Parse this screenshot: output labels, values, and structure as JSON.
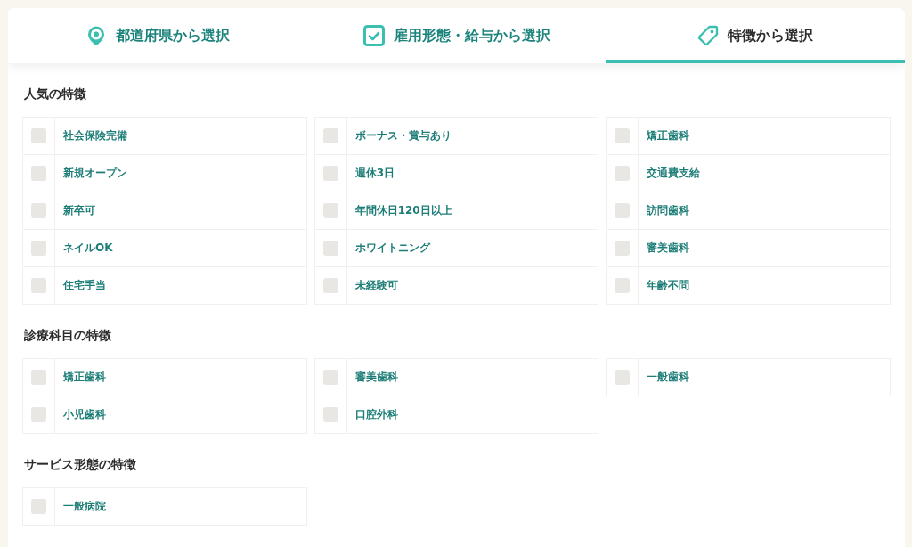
{
  "tabs": [
    {
      "kind": "pin",
      "label": "都道府県から選択",
      "selected": false
    },
    {
      "kind": "check",
      "label": "雇用形態・給与から選択",
      "selected": false
    },
    {
      "kind": "tag",
      "label": "特徴から選択",
      "selected": true
    }
  ],
  "sections": [
    {
      "title": "人気の特徴",
      "items": [
        {
          "label": "社会保険完備",
          "checked": false
        },
        {
          "label": "ボーナス・賞与あり",
          "checked": false
        },
        {
          "label": "矯正歯科",
          "checked": false
        },
        {
          "label": "新規オープン",
          "checked": false
        },
        {
          "label": "週休3日",
          "checked": false
        },
        {
          "label": "交通費支給",
          "checked": false
        },
        {
          "label": "新卒可",
          "checked": false
        },
        {
          "label": "年間休日120日以上",
          "checked": false
        },
        {
          "label": "訪問歯科",
          "checked": false
        },
        {
          "label": "ネイルOK",
          "checked": false
        },
        {
          "label": "ホワイトニング",
          "checked": false
        },
        {
          "label": "審美歯科",
          "checked": false
        },
        {
          "label": "住宅手当",
          "checked": false
        },
        {
          "label": "未経験可",
          "checked": false
        },
        {
          "label": "年齢不問",
          "checked": false
        }
      ]
    },
    {
      "title": "診療科目の特徴",
      "items": [
        {
          "label": "矯正歯科",
          "checked": false
        },
        {
          "label": "審美歯科",
          "checked": false
        },
        {
          "label": "一般歯科",
          "checked": false
        },
        {
          "label": "小児歯科",
          "checked": false
        },
        {
          "label": "口腔外科",
          "checked": false
        }
      ]
    },
    {
      "title": "サービス形態の特徴",
      "items": [
        {
          "label": "一般病院",
          "checked": false
        }
      ]
    }
  ]
}
